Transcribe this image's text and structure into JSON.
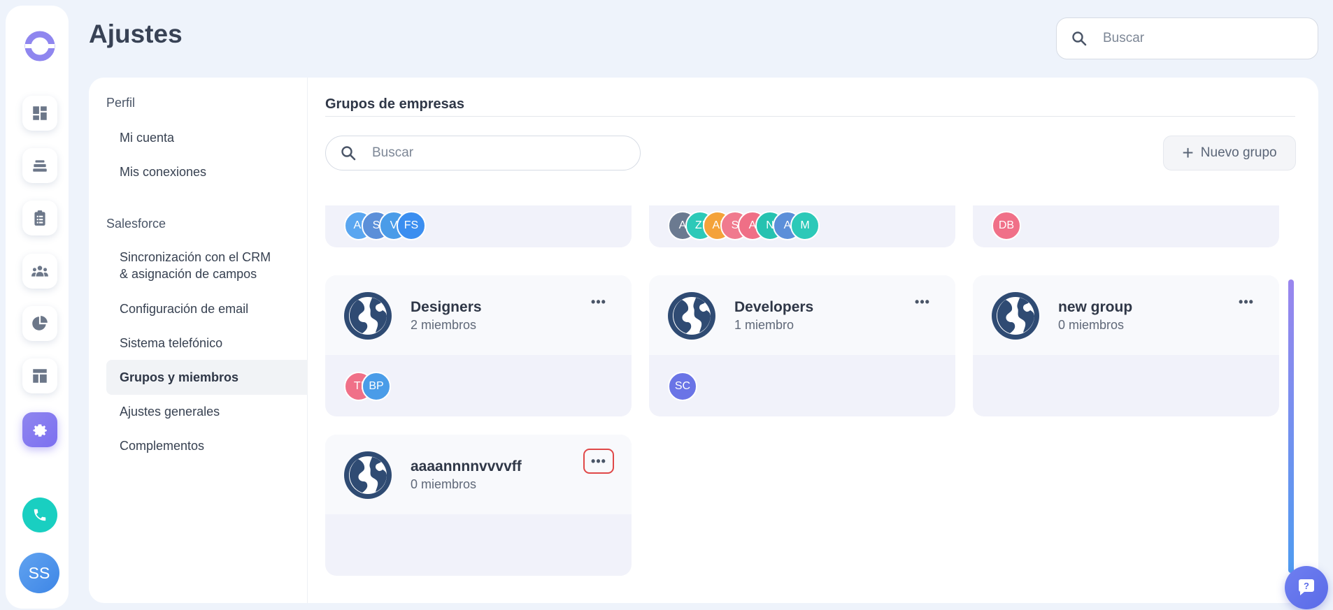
{
  "header": {
    "title": "Ajustes",
    "search_placeholder": "Buscar"
  },
  "rail": {
    "items": [
      "dashboard-icon",
      "stack-icon",
      "clipboard-icon",
      "team-icon",
      "pie-chart-icon",
      "layout-icon",
      "gear-icon"
    ],
    "active": "gear-icon",
    "user_initials": "SS",
    "accent": "#7c6ff0",
    "phone_color": "#19cfc1"
  },
  "sidebar": {
    "sections": [
      {
        "title": "Perfil",
        "items": [
          "Mi cuenta",
          "Mis conexiones"
        ]
      },
      {
        "title": "Salesforce",
        "items": [
          "Sincronización con el CRM & asignación de campos",
          "Configuración de email",
          "Sistema telefónico",
          "Grupos y miembros",
          "Ajustes generales",
          "Complementos"
        ]
      }
    ],
    "active_item": "Grupos y miembros"
  },
  "content": {
    "title": "Grupos de empresas",
    "search_placeholder": "Buscar",
    "new_group_label": "Nuevo grupo",
    "top_row_members": [
      [
        {
          "i": "AI",
          "c": "#5aa6f0"
        },
        {
          "i": "S",
          "c": "#5b8fd9"
        },
        {
          "i": "V",
          "c": "#4a9ce8"
        },
        {
          "i": "FS",
          "c": "#3b8ef0"
        }
      ],
      [
        {
          "i": "A",
          "c": "#6b7a90"
        },
        {
          "i": "ZI",
          "c": "#2cc9b8"
        },
        {
          "i": "AI",
          "c": "#f4a23a"
        },
        {
          "i": "S",
          "c": "#f07a8e"
        },
        {
          "i": "A",
          "c": "#ef6f86"
        },
        {
          "i": "N",
          "c": "#26c2b0"
        },
        {
          "i": "A",
          "c": "#5b8fd9"
        },
        {
          "i": "M",
          "c": "#2cc9b8"
        }
      ],
      [
        {
          "i": "DB",
          "c": "#f07088"
        }
      ]
    ],
    "groups": [
      {
        "name": "Designers",
        "count": "2 miembros",
        "members": [
          {
            "i": "TI",
            "c": "#f07088"
          },
          {
            "i": "BP",
            "c": "#4a9ce8"
          }
        ]
      },
      {
        "name": "Developers",
        "count": "1 miembro",
        "members": [
          {
            "i": "SC",
            "c": "#6a74e6"
          }
        ]
      },
      {
        "name": "new group",
        "count": "0 miembros",
        "members": []
      },
      {
        "name": "aaaannnnvvvvff",
        "count": "0 miembros",
        "members": []
      }
    ],
    "more_label": "•••"
  }
}
